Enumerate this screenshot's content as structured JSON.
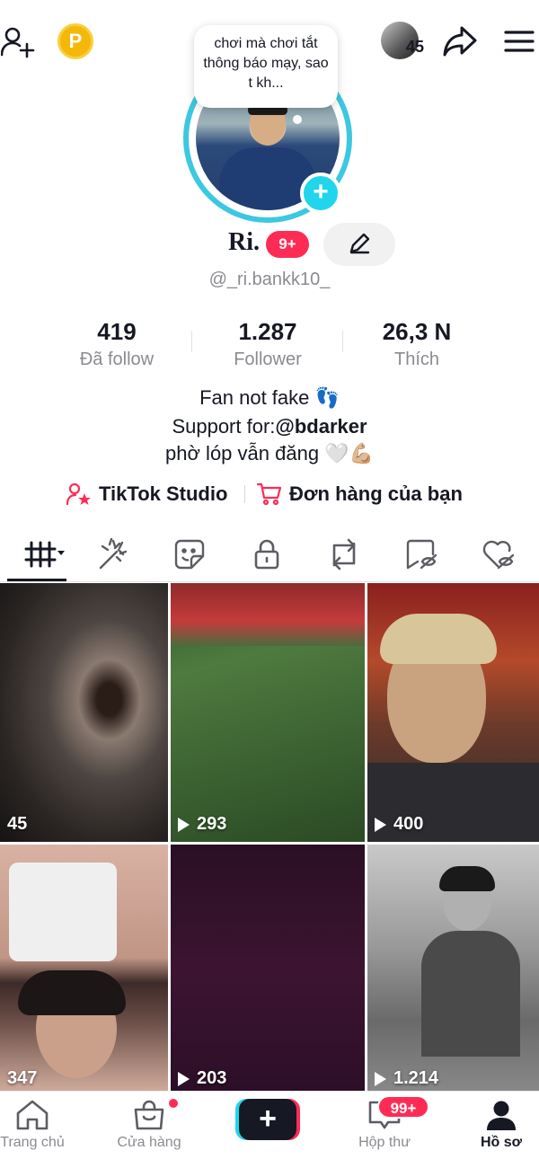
{
  "header": {
    "coin_letter": "P",
    "story_count": "45"
  },
  "profile": {
    "note_bubble": "chơi mà chơi tắt thông báo mạy, sao t kh...",
    "name": "Ri.",
    "name_badge": "9+",
    "username": "@_ri.bankk10_"
  },
  "stats": [
    {
      "value": "419",
      "label": "Đã follow"
    },
    {
      "value": "1.287",
      "label": "Follower"
    },
    {
      "value": "26,3 N",
      "label": "Thích"
    }
  ],
  "bio": {
    "line1": "Fan not fake 👣",
    "line2_prefix": "Support for:",
    "line2_mention": "@bdarker",
    "line3": "phờ lóp vẫn đăng 🤍💪🏼"
  },
  "links": {
    "studio": "TikTok Studio",
    "orders": "Đơn hàng của bạn"
  },
  "tabs": [
    "videos-grid",
    "effects",
    "stickers",
    "private",
    "reposts",
    "favorites",
    "liked"
  ],
  "videos": [
    {
      "count": "45",
      "play_icon": false
    },
    {
      "count": "293",
      "play_icon": true
    },
    {
      "count": "400",
      "play_icon": true
    },
    {
      "count": "347",
      "play_icon": false
    },
    {
      "count": "203",
      "play_icon": true
    },
    {
      "count": "1.214",
      "play_icon": true
    }
  ],
  "bottom_nav": {
    "home": "Trang chủ",
    "shop": "Cửa hàng",
    "inbox": "Hộp thư",
    "inbox_badge": "99+",
    "profile": "Hồ sơ"
  },
  "colors": {
    "accent_red": "#fe2c55",
    "accent_cyan": "#20d5ec",
    "text_primary": "#161823",
    "text_secondary": "#8a8b91"
  }
}
